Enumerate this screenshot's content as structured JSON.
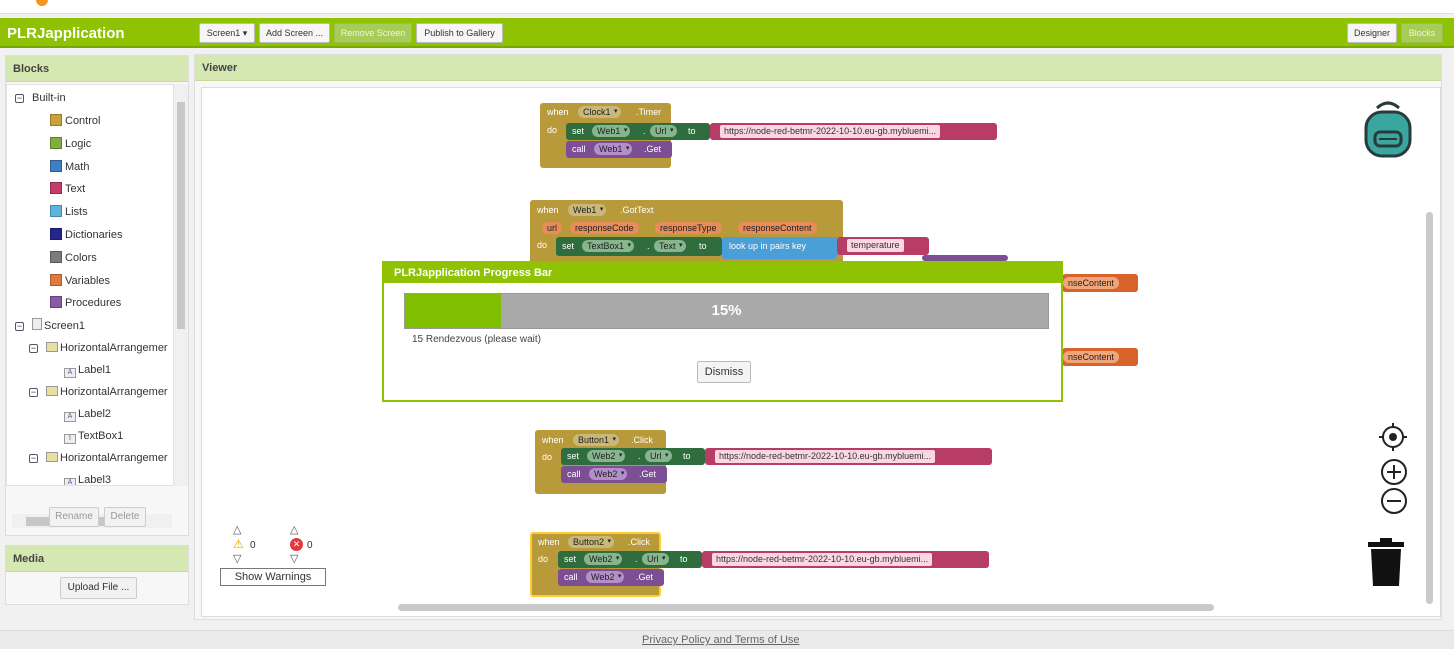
{
  "app": {
    "title": "PLRJapplication",
    "screen_dropdown": "Screen1 ▾",
    "add_screen": "Add Screen ...",
    "remove_screen": "Remove Screen",
    "publish": "Publish to Gallery",
    "designer": "Designer",
    "blocks": "Blocks"
  },
  "blocks_panel": {
    "header": "Blocks",
    "builtin": "Built-in",
    "builtins": [
      {
        "label": "Control",
        "color": "#c9a33a"
      },
      {
        "label": "Logic",
        "color": "#7fae3e"
      },
      {
        "label": "Math",
        "color": "#3e7ec2"
      },
      {
        "label": "Text",
        "color": "#c33c6b"
      },
      {
        "label": "Lists",
        "color": "#5fb4df"
      },
      {
        "label": "Dictionaries",
        "color": "#24248c"
      },
      {
        "label": "Colors",
        "color": "#7a7a7a"
      },
      {
        "label": "Variables",
        "color": "#e07b3e"
      },
      {
        "label": "Procedures",
        "color": "#8a5aa8"
      }
    ],
    "screen": "Screen1",
    "components": [
      {
        "label": "HorizontalArrangemer",
        "type": "arrangement"
      },
      {
        "label": "Label1",
        "type": "label"
      },
      {
        "label": "HorizontalArrangemer",
        "type": "arrangement"
      },
      {
        "label": "Label2",
        "type": "label"
      },
      {
        "label": "TextBox1",
        "type": "textbox"
      },
      {
        "label": "HorizontalArrangemer",
        "type": "arrangement"
      },
      {
        "label": "Label3",
        "type": "label"
      }
    ],
    "rename": "Rename",
    "delete": "Delete"
  },
  "media": {
    "header": "Media",
    "upload": "Upload File ..."
  },
  "viewer": {
    "header": "Viewer",
    "warnings_count": "0",
    "errors_count": "0",
    "show_warnings": "Show Warnings"
  },
  "blocks": {
    "when": "when",
    "do": "do",
    "set": "set",
    "call": "call",
    "to": "to",
    "dot": ".",
    "clock1": "Clock1",
    "timer": ".Timer",
    "web1": "Web1",
    "web2": "Web2",
    "url": "Url",
    "get": ".Get",
    "gottext": ".GotText",
    "params": [
      "url",
      "responseCode",
      "responseType",
      "responseContent"
    ],
    "textbox1": "TextBox1",
    "text": "Text",
    "lookup": "look up in pairs  key",
    "temperature": "temperature",
    "response_content_partial": "nseContent",
    "button1": "Button1",
    "button2": "Button2",
    "click": ".Click",
    "url_text": "https://node-red-betmr-2022-10-10.eu-gb.mybluemi..."
  },
  "progress_dialog": {
    "title": "PLRJapplication Progress Bar",
    "percent": 15,
    "percent_text": "15%",
    "message": "15 Rendezvous (please wait)",
    "dismiss": "Dismiss"
  },
  "footer": {
    "link": "Privacy Policy and Terms of Use"
  }
}
